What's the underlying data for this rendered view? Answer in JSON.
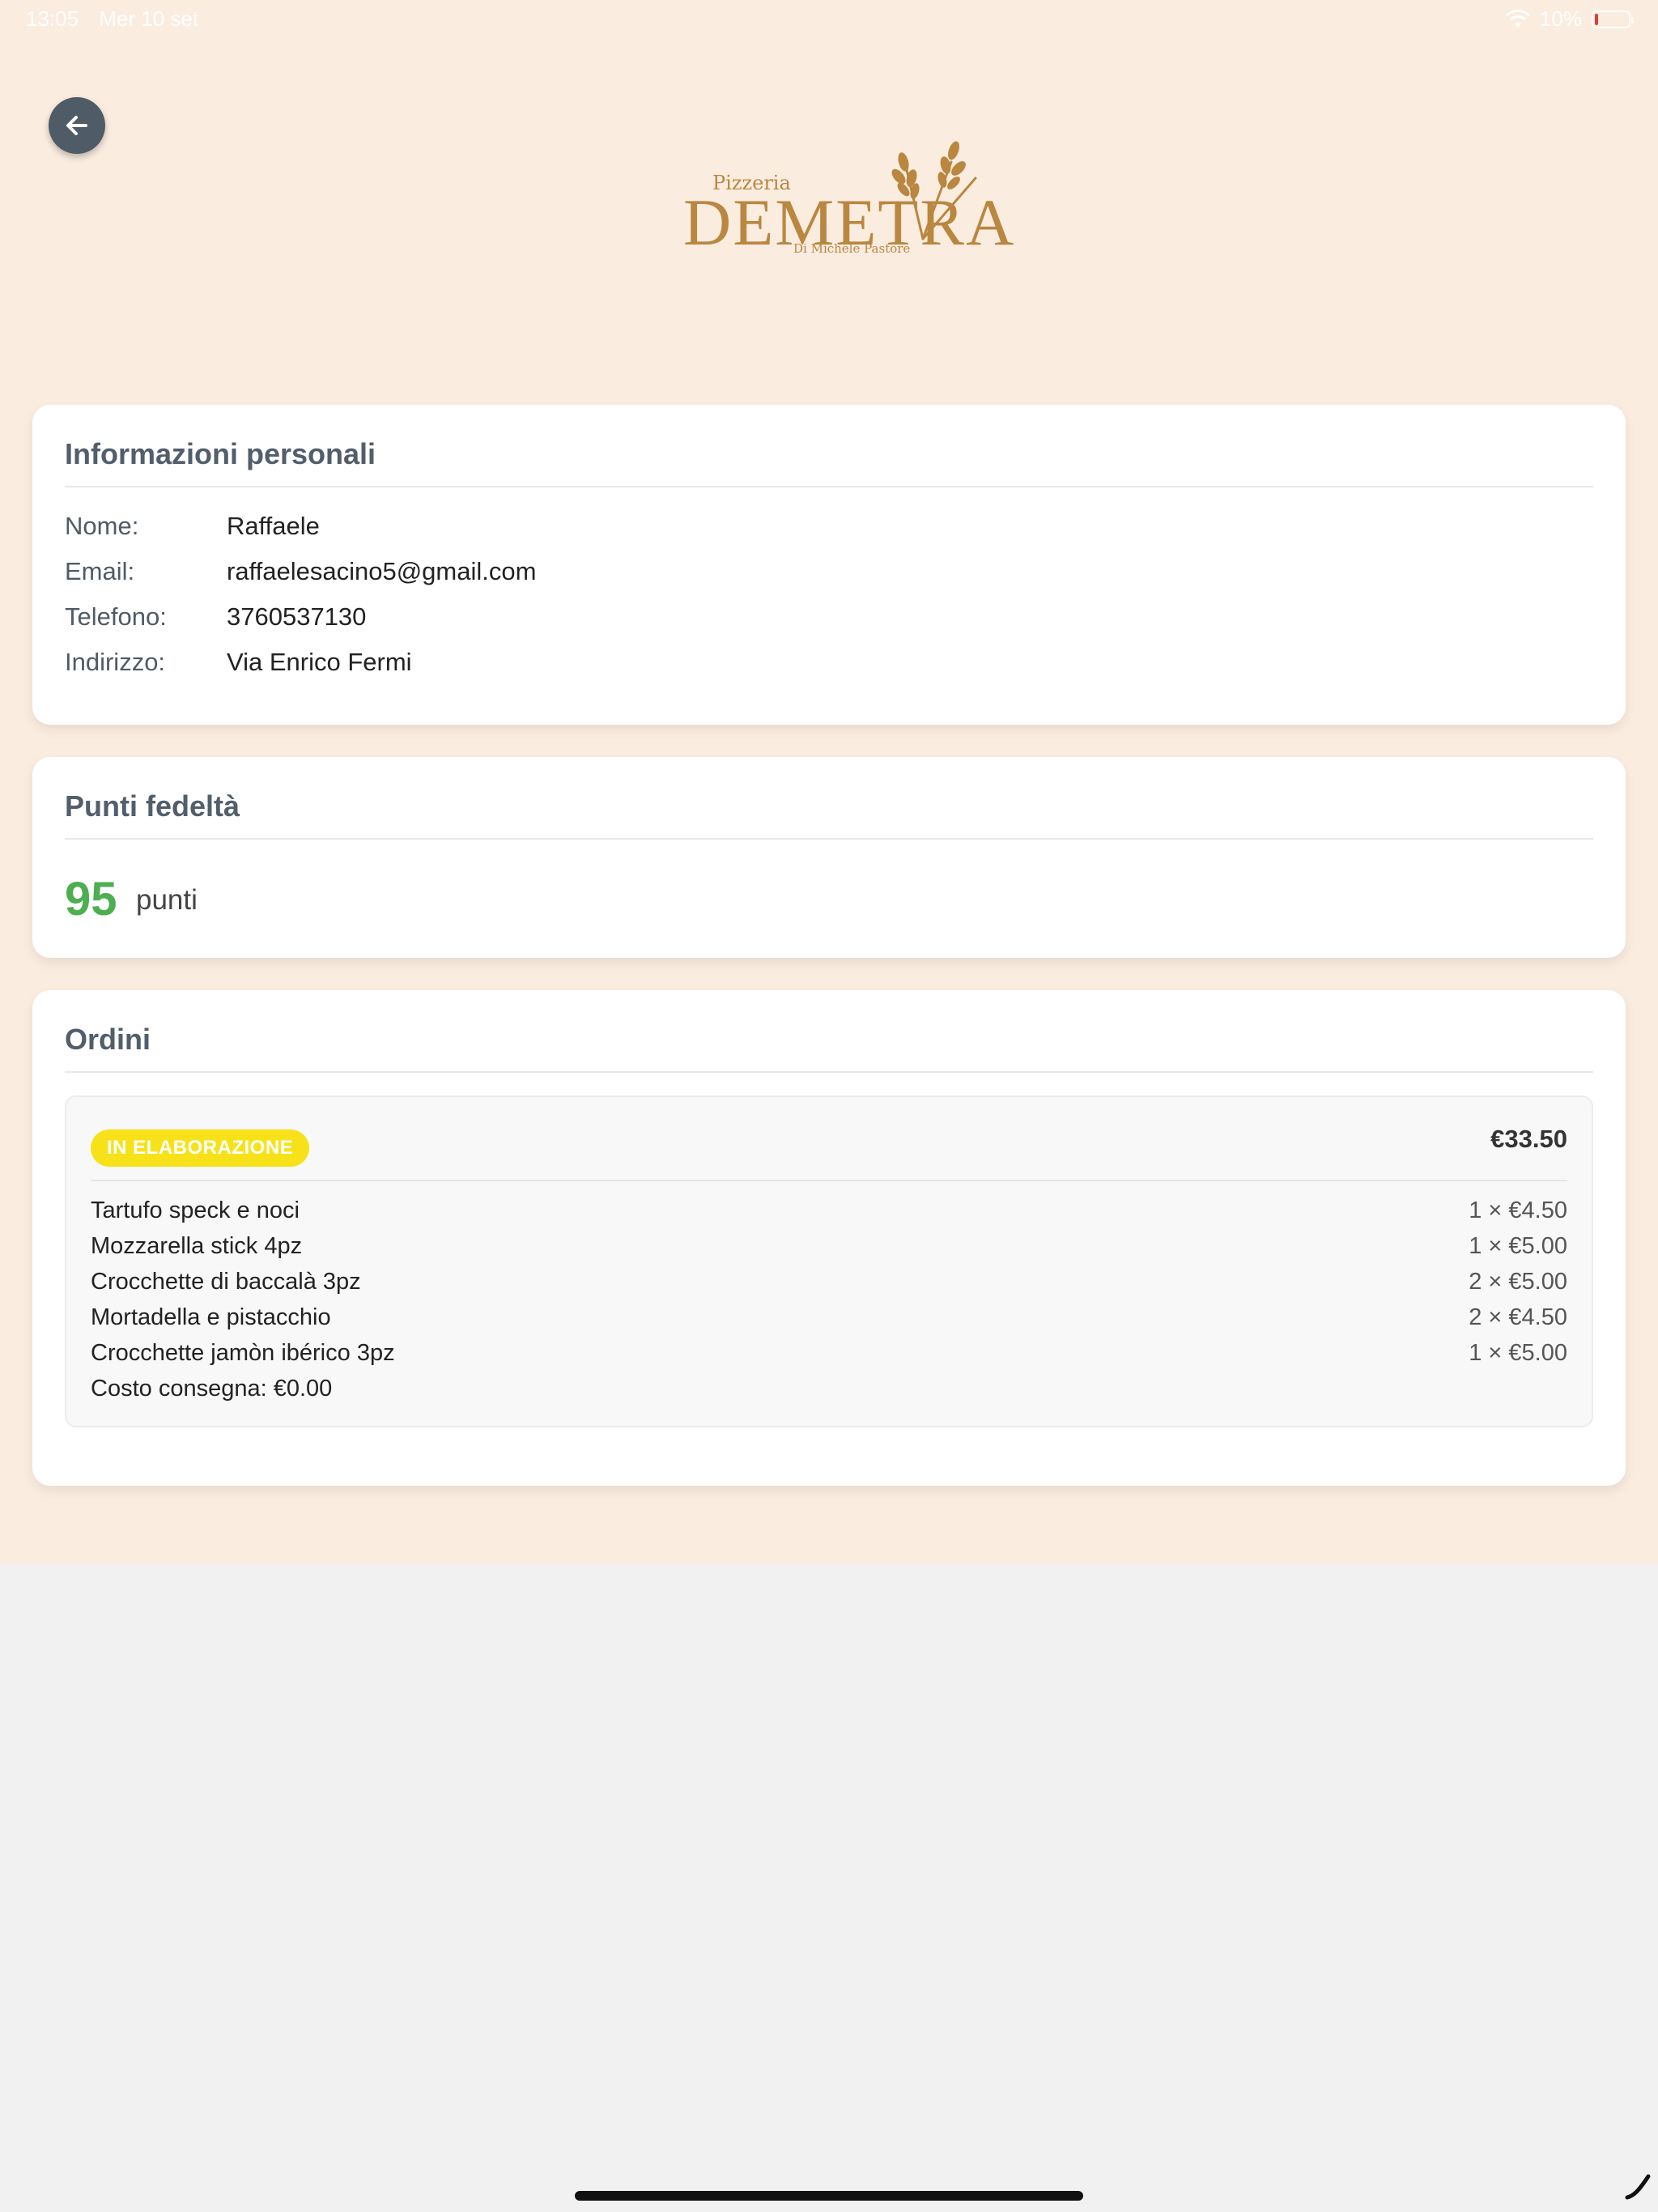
{
  "status_bar": {
    "time": "13:05",
    "date": "Mer 10 set",
    "battery_percent": "10%",
    "icons": [
      "wifi-icon",
      "battery-icon"
    ]
  },
  "header": {
    "back_icon": "arrow-left-icon",
    "logo": {
      "small_text": "Pizzeria",
      "brand": "DEMETRA",
      "subtitle": "Di Michele Pastore"
    }
  },
  "personal_info": {
    "title": "Informazioni personali",
    "rows": [
      {
        "label": "Nome:",
        "value": "Raffaele"
      },
      {
        "label": "Email:",
        "value": "raffaelesacino5@gmail.com"
      },
      {
        "label": "Telefono:",
        "value": "3760537130"
      },
      {
        "label": "Indirizzo:",
        "value": "Via Enrico Fermi"
      }
    ]
  },
  "loyalty": {
    "title": "Punti fedeltà",
    "points": "95",
    "unit": "punti",
    "accent_color": "#4caf50"
  },
  "orders": {
    "title": "Ordini",
    "list": [
      {
        "status": "IN ELABORAZIONE",
        "status_color": "#f7e21a",
        "total": "€33.50",
        "items": [
          {
            "name": "Tartufo speck e noci",
            "qty": "1 × €4.50"
          },
          {
            "name": "Mozzarella stick 4pz",
            "qty": "1 × €5.00"
          },
          {
            "name": "Crocchette di baccalà 3pz",
            "qty": "2 × €5.00"
          },
          {
            "name": "Mortadella e pistacchio",
            "qty": "2 × €4.50"
          },
          {
            "name": "Crocchette jamòn ibérico 3pz",
            "qty": "1 × €5.00"
          }
        ],
        "delivery": "Costo consegna: €0.00"
      }
    ]
  }
}
